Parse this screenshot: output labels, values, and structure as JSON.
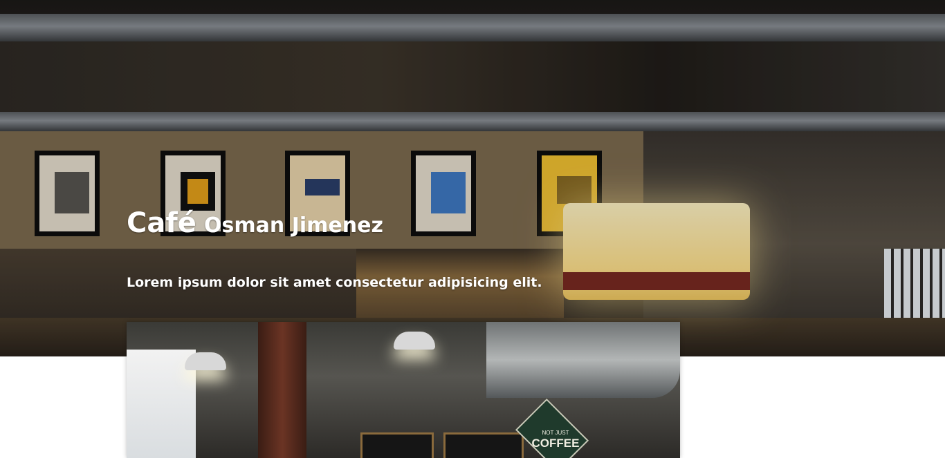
{
  "hero": {
    "title_main": "Café",
    "title_rest": "Osman Jimenez",
    "subtitle": "Lorem ipsum dolor sit amet consectetur adipisicing elit."
  },
  "images": {
    "hero_background": "cafe-interior-photo",
    "secondary_photo": "cafe-coffee-bar-photo",
    "coffee_sign_top": "NOT JUST",
    "coffee_sign_main": "COFFEE"
  },
  "colors": {
    "text": "#ffffff",
    "page_background": "#ffffff"
  }
}
